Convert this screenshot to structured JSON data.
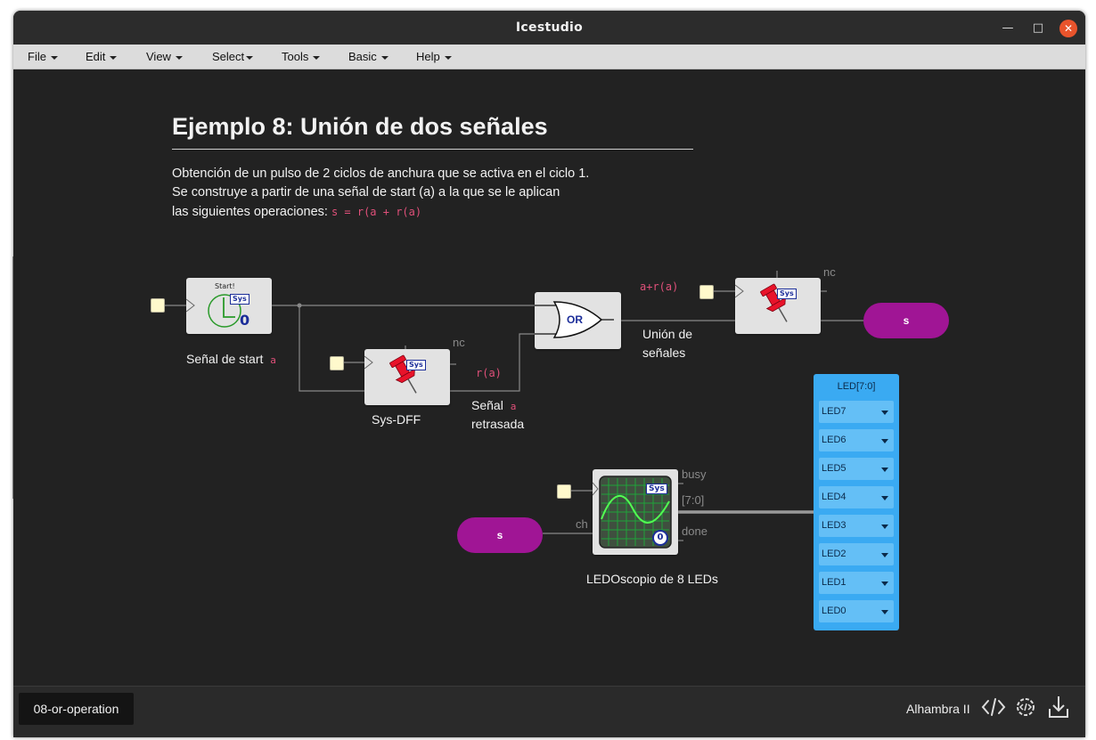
{
  "window": {
    "title": "Icestudio"
  },
  "menu": [
    {
      "label": "File"
    },
    {
      "label": "Edit"
    },
    {
      "label": "View"
    },
    {
      "label": "Select"
    },
    {
      "label": "Tools"
    },
    {
      "label": "Basic"
    },
    {
      "label": "Help"
    }
  ],
  "canvas": {
    "heading": "Ejemplo 8: Unión de dos señales",
    "desc_line1": "Obtención de un pulso de 2 ciclos de anchura que se activa en el ciclo 1.",
    "desc_line2": "Se construye a partir de una señal de start (a) a la que se le aplican",
    "desc_line3": "las siguientes operaciones:",
    "desc_formula": "s = r(a + r(a)",
    "start_block": {
      "title": "Start!",
      "sys": "Sys",
      "value": "0",
      "caption": "Señal de start",
      "caption_code": "a"
    },
    "dff1": {
      "sys": "Sys",
      "nc": "nc",
      "caption": "Sys-DFF",
      "out_label": "r(a)"
    },
    "delayed_caption_1": "Señal",
    "delayed_caption_code": "a",
    "delayed_caption_2": "retrasada",
    "or_gate": {
      "label": "OR",
      "out_label": "a+r(a)",
      "caption_1": "Unión de",
      "caption_2": "señales"
    },
    "dff2": {
      "sys": "Sys",
      "nc": "nc"
    },
    "out_label_s": "s",
    "in_label_s": "s",
    "ledoscope": {
      "sys": "Sys",
      "value": "0",
      "port_ch": "ch",
      "port_busy": "busy",
      "port_bus": "[7:0]",
      "port_done": "done",
      "caption": "LEDOscopio de 8 LEDs"
    },
    "led_panel": {
      "title": "LED[7:0]",
      "leds": [
        "LED7",
        "LED6",
        "LED5",
        "LED4",
        "LED3",
        "LED2",
        "LED1",
        "LED0"
      ]
    }
  },
  "status": {
    "file_tab": "08-or-operation",
    "board": "Alhambra II"
  },
  "colors": {
    "canvas_bg": "#222222",
    "label_pill": "#a01595",
    "led_panel": "#3aaaf2",
    "code_text": "#e0507a"
  },
  "icons": [
    "chevron-down-icon",
    "minimize-icon",
    "maximize-icon",
    "close-icon",
    "code-icon",
    "gear-code-icon",
    "download-icon",
    "pin-icon",
    "clock-icon",
    "scope-icon"
  ]
}
